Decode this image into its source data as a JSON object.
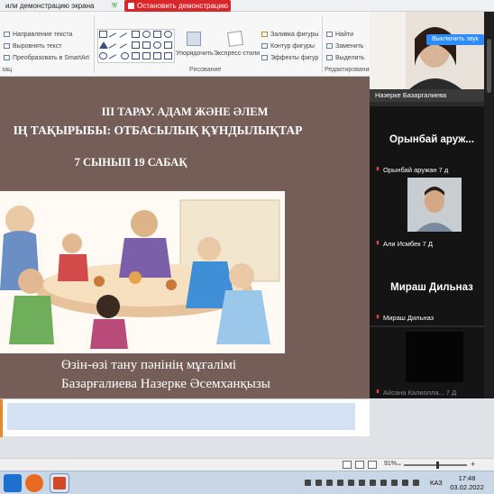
{
  "share_bar": {
    "title": "или демонстрацию экрана",
    "stop_label": "Остановить демонстрацию"
  },
  "ribbon": {
    "paragraph_items": [
      "Направление текста",
      "Выровнять текст",
      "Преобразовать в SmartArt"
    ],
    "paragraph_group": "зац",
    "arrange_label": "Упорядочить",
    "quick_styles_label": "Экспресс-стили",
    "drawing_group": "Рисование",
    "shape_format_items": [
      "Заливка фигуры",
      "Контур фигуры",
      "Эффекты фигур"
    ],
    "editing_items": [
      "Найти",
      "Заменить",
      "Выделить"
    ],
    "editing_group": "Редактирование"
  },
  "slide": {
    "line1": "III ТАРАУ. АДАМ ЖӘНЕ ӘЛЕМ",
    "line2": "ІҢ ТАҚЫРЫБЫ: ОТБАСЫЛЫҚ ҚҰНДЫЛЫҚТАР",
    "line3": "7 СЫНЫП        19 САБАҚ",
    "sig1": "Өзін-өзі тану пәнінің мұғалімі",
    "sig2": "Базарғалиева Назерке Әсемханқызы"
  },
  "status_bar": {
    "zoom": "91%",
    "zoom_minus": "−",
    "zoom_plus": "+"
  },
  "taskbar": {
    "time": "17:48",
    "date": "03.02.2022",
    "lang": "КАЗ"
  },
  "meeting": {
    "unmute_label": "Выключить звук",
    "participants": [
      {
        "name": "Назерке Базаргалиева",
        "muted": false
      },
      {
        "big_name": "Орынбай аруж...",
        "name": "Орынбай аружан 7 д",
        "muted": true
      },
      {
        "name": "Али Исмбек 7 Д",
        "muted": true
      },
      {
        "big_name": "Мираш Дильназ",
        "name": "Мираш Дильназ",
        "muted": true
      },
      {
        "name": "Айсана Калиолла... 7 Д",
        "muted": true
      }
    ]
  },
  "colors": {
    "slide_bg": "#765e58",
    "stop_red": "#d9262a",
    "zoom_blue": "#2d8cff",
    "panel_bg": "#2a2a2a"
  }
}
